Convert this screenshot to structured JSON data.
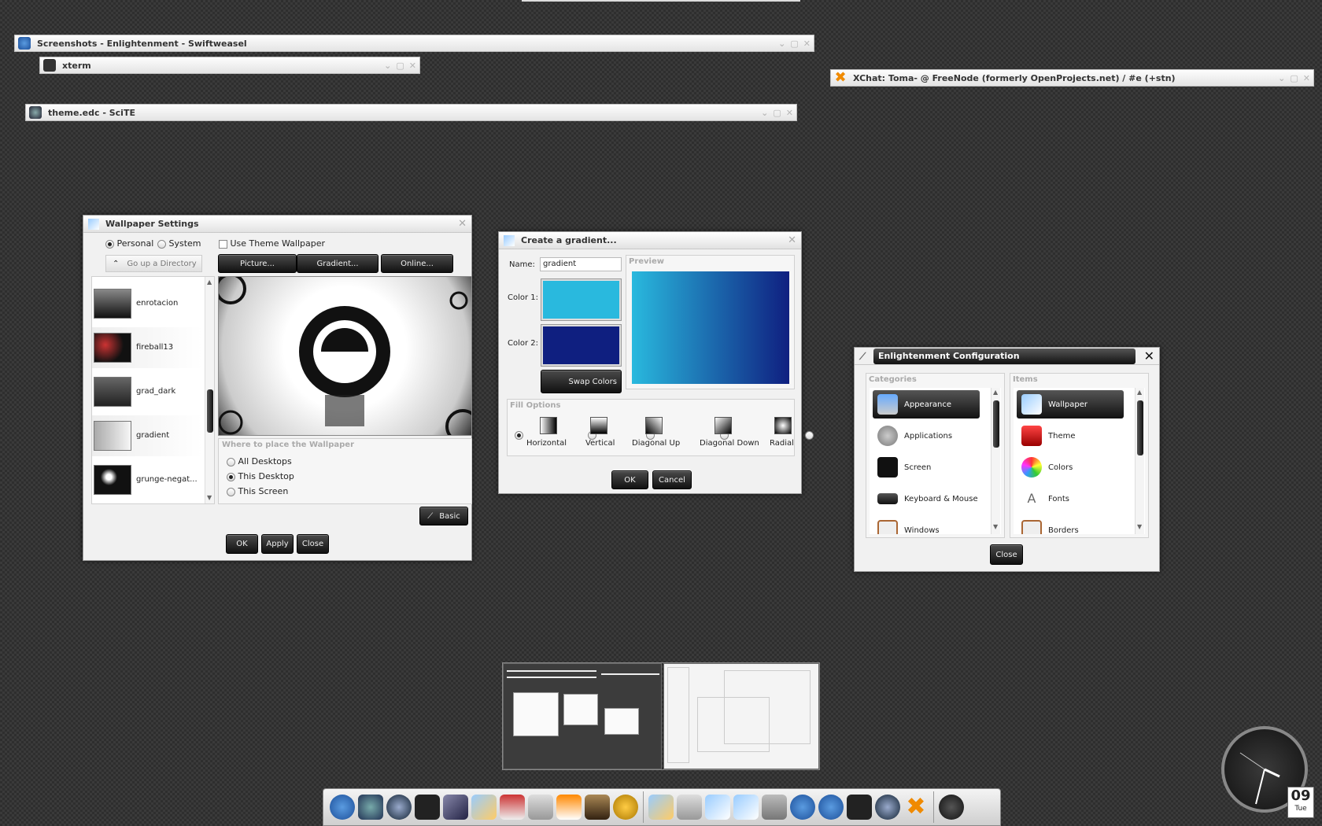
{
  "colors": {
    "gradient_color1": "#29b9de",
    "gradient_color2": "#0f1f80",
    "accent": "#111111"
  },
  "shaded_windows": [
    {
      "title": "Screenshots - Enlightenment - Swiftweasel",
      "icon": "firefox-icon"
    },
    {
      "title": "xterm",
      "icon": "terminal-icon"
    },
    {
      "title": "theme.edc - SciTE",
      "icon": "scite-icon"
    },
    {
      "title": "XChat: Toma- @ FreeNode (formerly OpenProjects.net) / #e (+stn)",
      "icon": "xchat-icon"
    }
  ],
  "wallpaper": {
    "title": "Wallpaper Settings",
    "personal": "Personal",
    "system": "System",
    "use_theme": "Use Theme Wallpaper",
    "go_up": "Go up a Directory",
    "picture_btn": "Picture...",
    "gradient_btn": "Gradient...",
    "online_btn": "Online...",
    "items": [
      "enrotacion",
      "fireball13",
      "grad_dark",
      "gradient",
      "grunge-negat..."
    ],
    "place_label": "Where to place the Wallpaper",
    "opt_all": "All Desktops",
    "opt_this": "This Desktop",
    "opt_screen": "This Screen",
    "basic_btn": "Basic",
    "ok": "OK",
    "apply": "Apply",
    "close": "Close"
  },
  "gradient": {
    "title": "Create a gradient...",
    "name_label": "Name:",
    "name_value": "gradient",
    "preview_label": "Preview",
    "color1_label": "Color 1:",
    "color2_label": "Color 2:",
    "swap": "Swap Colors",
    "fill_label": "Fill Options",
    "fills": [
      "Horizontal",
      "Vertical",
      "Diagonal Up",
      "Diagonal Down",
      "Radial"
    ],
    "ok": "OK",
    "cancel": "Cancel"
  },
  "econfig": {
    "title": "Enlightenment Configuration",
    "categories_label": "Categories",
    "items_label": "Items",
    "categories": [
      "Appearance",
      "Applications",
      "Screen",
      "Keyboard & Mouse",
      "Windows"
    ],
    "items": [
      "Wallpaper",
      "Theme",
      "Colors",
      "Fonts",
      "Borders"
    ],
    "close": "Close"
  },
  "clock": {
    "day": "09",
    "weekday": "Tue"
  }
}
